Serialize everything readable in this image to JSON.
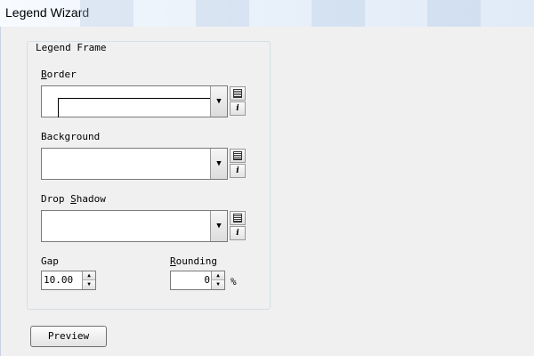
{
  "window": {
    "title": "Legend Wizard"
  },
  "frame": {
    "group_label": "Legend Frame",
    "border": {
      "label_pre": "",
      "label_u": "B",
      "label_post": "order"
    },
    "background": {
      "label": "Background"
    },
    "drop_shadow": {
      "label_pre": "Drop ",
      "label_u": "S",
      "label_post": "hadow"
    },
    "gap": {
      "label": "Gap",
      "value": "10.00"
    },
    "rounding": {
      "label_u": "R",
      "label_post": "ounding",
      "value": "0",
      "unit": "%"
    }
  },
  "icons": {
    "dropdown": "▼",
    "list": "list-icon",
    "info": "i",
    "spin_up": "▲",
    "spin_down": "▼"
  },
  "preview_button": {
    "label": "Preview"
  }
}
